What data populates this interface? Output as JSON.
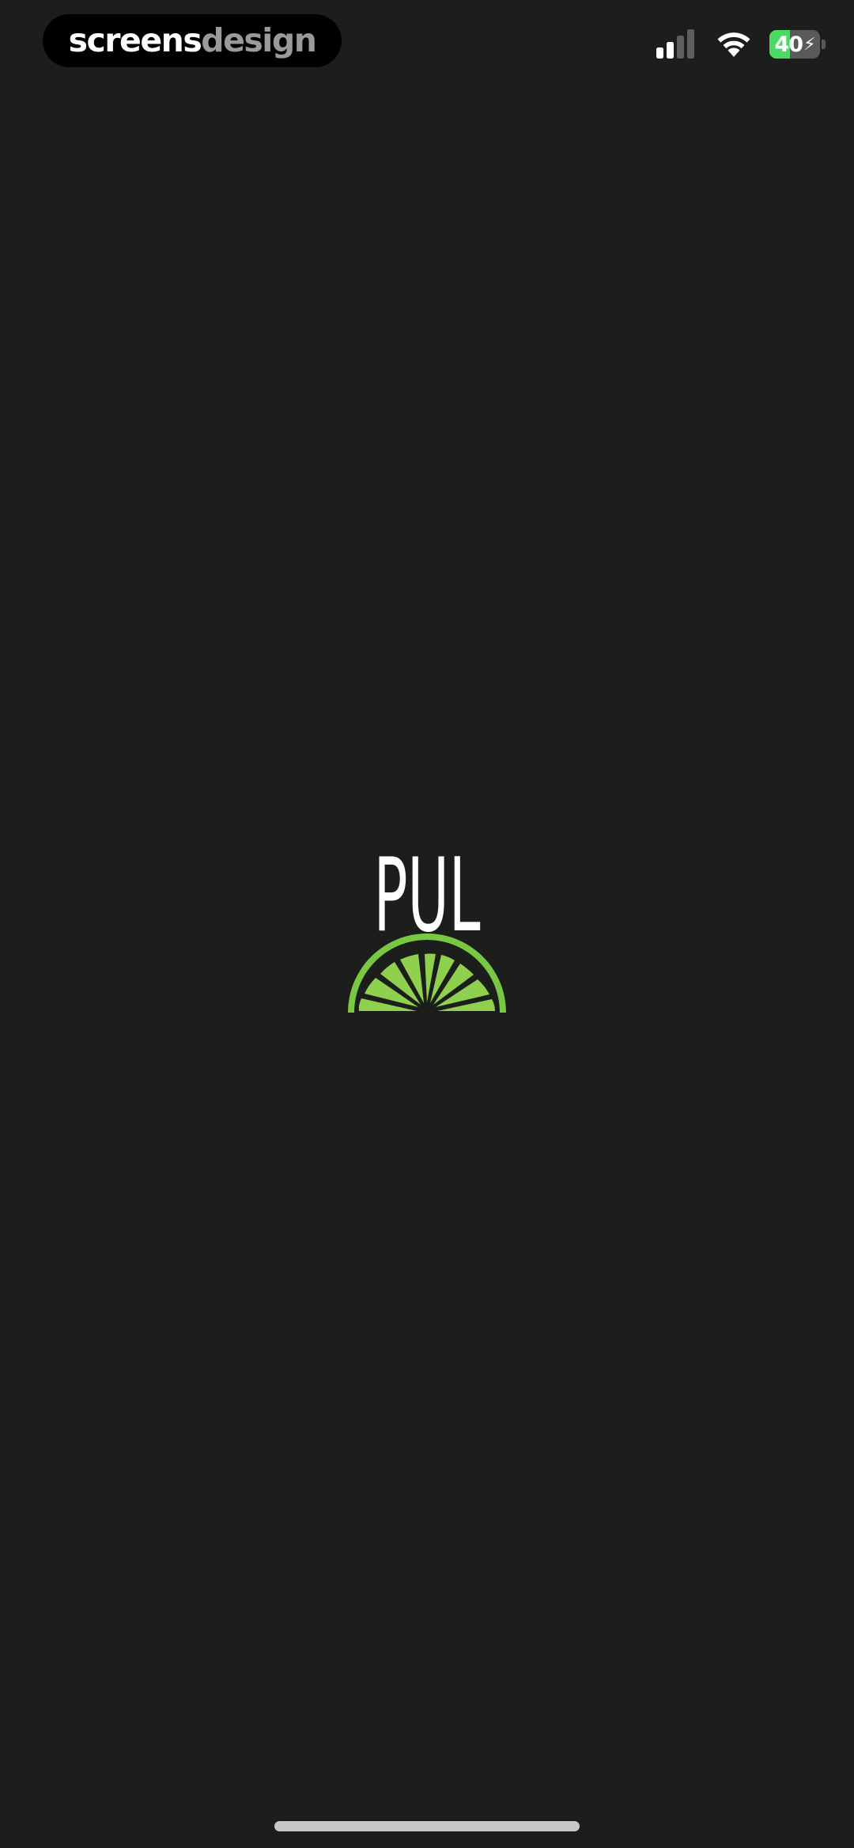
{
  "watermark": {
    "part1": "screens",
    "part2": "design"
  },
  "status_bar": {
    "signal_icon": "cellular-signal-icon",
    "wifi_icon": "wifi-icon",
    "battery": {
      "level_text": "40",
      "level_fraction": 0.4,
      "charging_icon": "charging-bolt-icon",
      "fill_color": "#4cd964"
    }
  },
  "logo": {
    "text": "PUL",
    "icon": "lime-slice-icon",
    "text_color": "#ffffff",
    "lime_colors": {
      "rind": "#79c843",
      "segment": "#8fd14f",
      "segment_dark": "#5aa830"
    }
  },
  "colors": {
    "background": "#1b1e1a"
  }
}
